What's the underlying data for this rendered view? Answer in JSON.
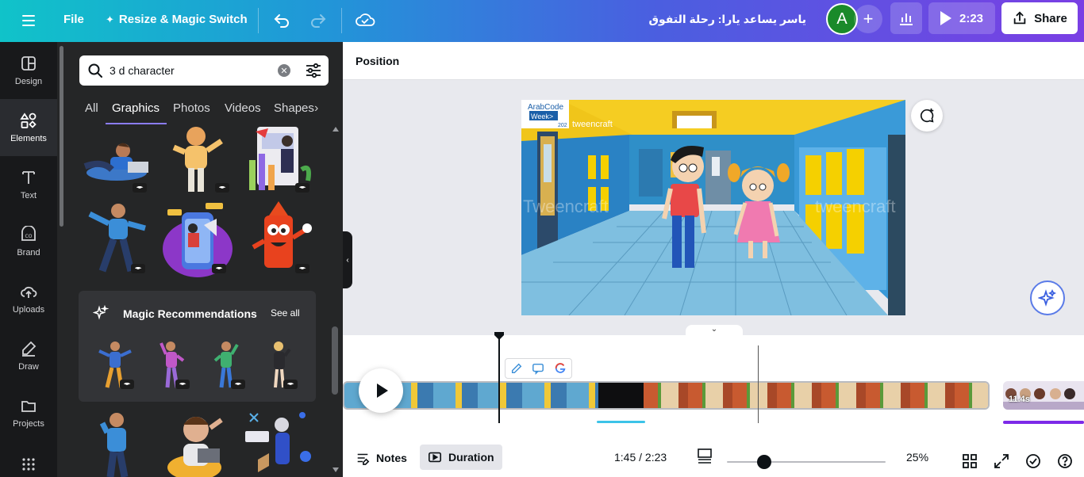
{
  "topbar": {
    "file_label": "File",
    "resize_label": "Resize & Magic Switch",
    "design_title": "ياسر يساعد يارا: رحلة التفوق",
    "avatar_initial": "A",
    "play_duration": "2:23",
    "share_label": "Share"
  },
  "rail": {
    "items": [
      {
        "label": "Design",
        "icon": "layout-icon"
      },
      {
        "label": "Elements",
        "icon": "shapes-icon"
      },
      {
        "label": "Text",
        "icon": "text-icon"
      },
      {
        "label": "Brand",
        "icon": "brand-icon"
      },
      {
        "label": "Uploads",
        "icon": "upload-cloud-icon"
      },
      {
        "label": "Draw",
        "icon": "draw-icon"
      },
      {
        "label": "Projects",
        "icon": "folder-icon"
      }
    ],
    "active": "Elements"
  },
  "panel": {
    "search_value": "3 d character",
    "tabs": [
      "All",
      "Graphics",
      "Photos",
      "Videos",
      "Shapes"
    ],
    "active_tab": "Graphics",
    "magic": {
      "title": "Magic Recommendations",
      "see_all": "See all"
    }
  },
  "canvas": {
    "position_label": "Position",
    "watermark_badge_line1": "ArabCode",
    "watermark_badge_line2": "Week>",
    "watermark_badge_year": "202",
    "tweencraft_small": "tweencraft",
    "tweencraft_ghost_left": "Tweencraft",
    "tweencraft_ghost_right": "tweencraft"
  },
  "timeline": {
    "next_clip_duration": "11.4s"
  },
  "bottombar": {
    "notes_label": "Notes",
    "duration_label": "Duration",
    "time_readout": "1:45 / 2:23",
    "zoom_value": "25%",
    "zoom_fraction": 0.25
  },
  "colors": {
    "accent": "#8b7cf6",
    "avatar_bg": "#1a8a2a",
    "timeline_selection": "#3cc3e8",
    "next_clip_bar": "#7d2ae8"
  }
}
